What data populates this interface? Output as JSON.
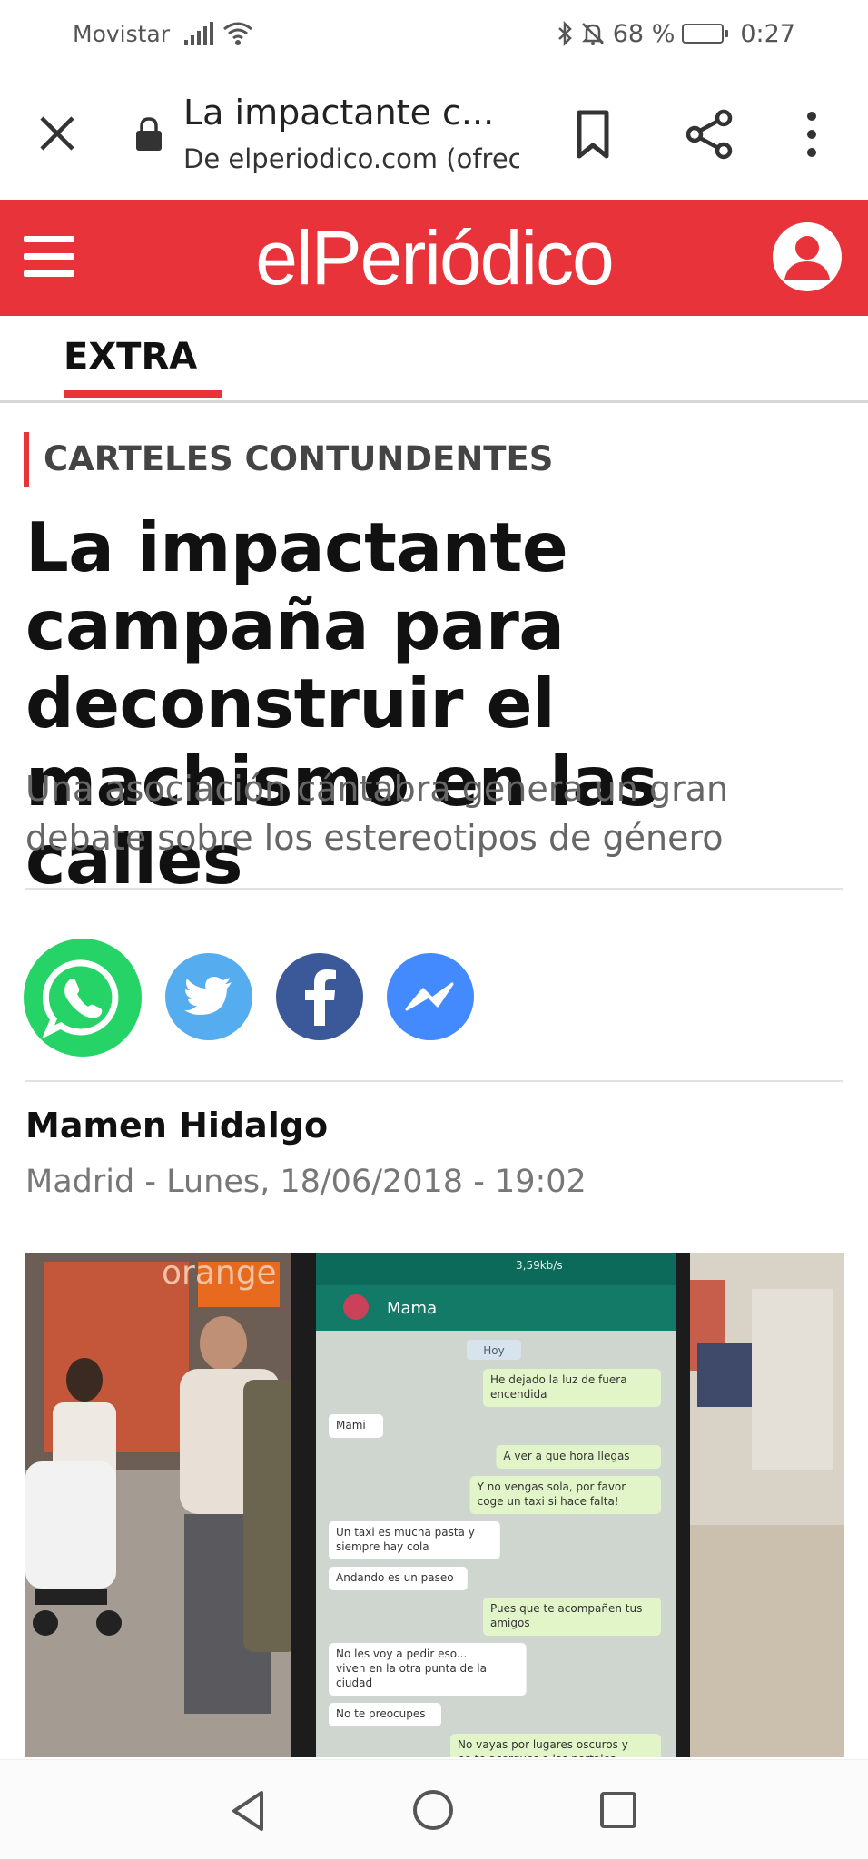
{
  "status_bar": {
    "carrier": "Movistar",
    "battery_percent": "68 %",
    "battery_level": 0.68,
    "time": "0:27"
  },
  "toolbar": {
    "title": "La impactante c...",
    "subtitle": "De elperiodico.com (ofrec",
    "icons": [
      "close-icon",
      "lock-icon",
      "bookmark-icon",
      "share-icon",
      "more-vert-icon"
    ]
  },
  "header": {
    "brand": "elPeriódico",
    "bg_color": "#e8333a"
  },
  "section_tab": "EXTRA",
  "article": {
    "kicker": "CARTELES CONTUNDENTES",
    "headline": "La impactante campaña para deconstruir el machismo en las calles",
    "subheadline": "Una asociación cántabra genera un gran debate sobre los estereotipos de género",
    "author": "Mamen Hidalgo",
    "dateline": "Madrid - Lunes, 18/06/2018 - 19:02",
    "share_buttons": [
      "whatsapp",
      "twitter",
      "facebook",
      "messenger"
    ]
  },
  "photo": {
    "store_sign": "orange",
    "phone_time": "3,59kb/s",
    "chat_contact": "Mama",
    "chat_day": "Hoy",
    "messages": [
      {
        "side": "out",
        "text": "He dejado la luz de fuera encendida"
      },
      {
        "side": "in",
        "text": "Mami"
      },
      {
        "side": "out",
        "text": "A ver a que hora llegas"
      },
      {
        "side": "out",
        "text": "Y no vengas sola, por favor coge un taxi si hace falta!"
      },
      {
        "side": "in",
        "text": "Un taxi es mucha pasta y siempre hay cola"
      },
      {
        "side": "in",
        "text": "Andando es un paseo"
      },
      {
        "side": "out",
        "text": "Pues que te acompañen tus amigos"
      },
      {
        "side": "in",
        "text": "No les voy a pedir eso... viven en la otra punta de la ciudad"
      },
      {
        "side": "in",
        "text": "No te preocupes"
      },
      {
        "side": "out",
        "text": "No vayas por lugares oscuros y no te acerques a los portales que nunca sabes"
      }
    ]
  },
  "colors": {
    "accent_red": "#e8333a",
    "whatsapp": "#25d366",
    "twitter": "#55acee",
    "facebook": "#3b5998",
    "messenger": "#448aff"
  }
}
